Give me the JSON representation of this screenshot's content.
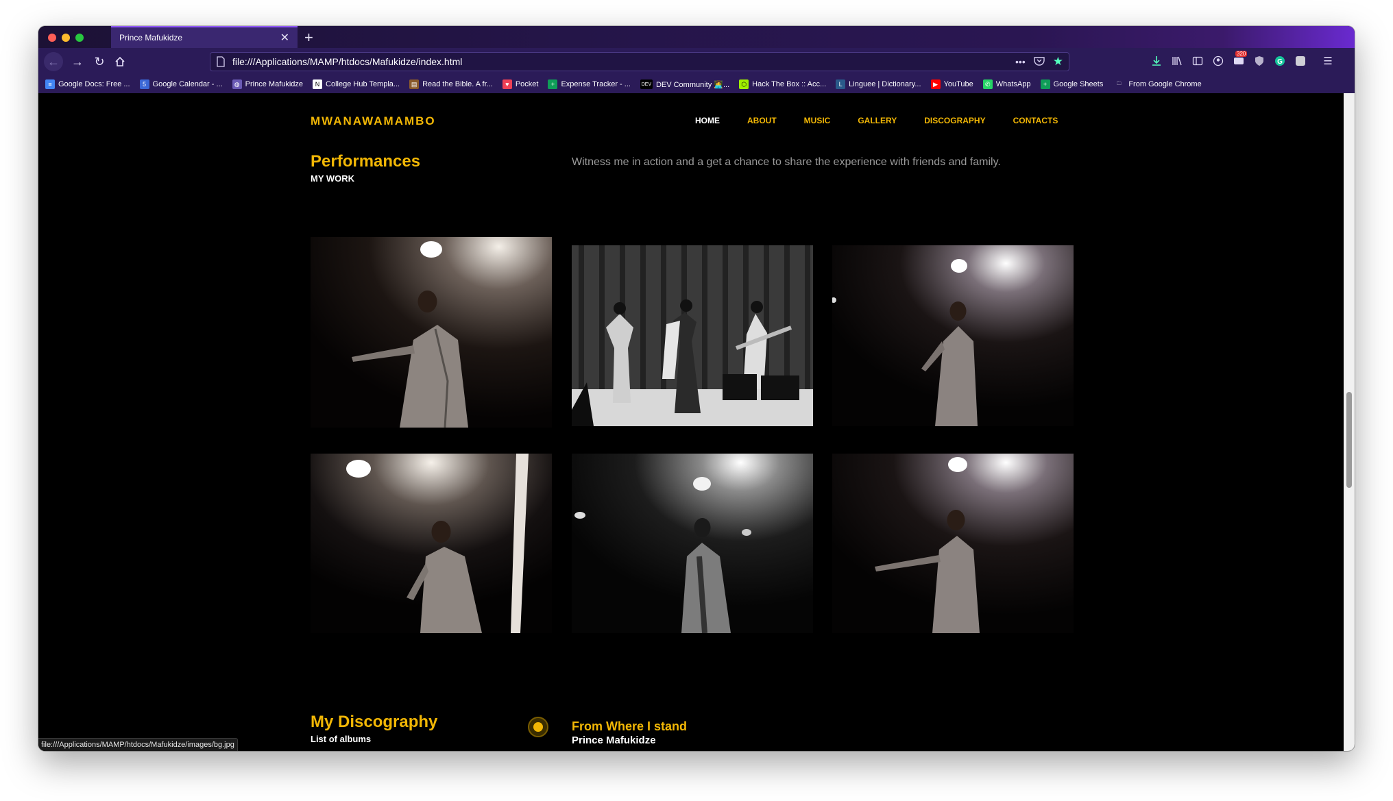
{
  "browser": {
    "tab_title": "Prince Mafukidze",
    "url": "file:///Applications/MAMP/htdocs/Mafukidze/index.html",
    "badge_count": "320",
    "bookmarks": [
      {
        "label": "Google Docs: Free ...",
        "color": "#4285f4",
        "glyph": "≡"
      },
      {
        "label": "Google Calendar - ...",
        "color": "#3b67d6",
        "glyph": "5"
      },
      {
        "label": "Prince Mafukidze",
        "color": "#6b5bb5",
        "glyph": "◍"
      },
      {
        "label": "College Hub Templa...",
        "color": "#ffffff",
        "glyph": "N"
      },
      {
        "label": "Read the Bible. A fr...",
        "color": "#8a5a2b",
        "glyph": "▤"
      },
      {
        "label": "Pocket",
        "color": "#ef4056",
        "glyph": "♥"
      },
      {
        "label": "Expense Tracker - ...",
        "color": "#0f9d58",
        "glyph": "+"
      },
      {
        "label": "DEV Community 👩‍💻...",
        "color": "#000000",
        "glyph": "DEV"
      },
      {
        "label": "Hack The Box :: Acc...",
        "color": "#9fef00",
        "glyph": "⬡"
      },
      {
        "label": "Linguee | Dictionary...",
        "color": "#2a5a8a",
        "glyph": "L"
      },
      {
        "label": "YouTube",
        "color": "#ff0000",
        "glyph": "▶"
      },
      {
        "label": "WhatsApp",
        "color": "#25d366",
        "glyph": "✆"
      },
      {
        "label": "Google Sheets",
        "color": "#0f9d58",
        "glyph": "+"
      },
      {
        "label": "From Google Chrome",
        "color": "transparent",
        "glyph": "🗀"
      }
    ],
    "status_url": "file:///Applications/MAMP/htdocs/Mafukidze/images/bg.jpg"
  },
  "site": {
    "brand": "MWANAWAMAMBO",
    "nav": [
      {
        "label": "HOME",
        "active": true
      },
      {
        "label": "ABOUT",
        "active": false
      },
      {
        "label": "MUSIC",
        "active": false
      },
      {
        "label": "GALLERY",
        "active": false
      },
      {
        "label": "DISCOGRAPHY",
        "active": false
      },
      {
        "label": "CONTACTS",
        "active": false
      }
    ],
    "performances": {
      "title": "Performances",
      "subtitle": "MY WORK",
      "description": "Witness me in action and a get a chance to share the experience with friends and family."
    },
    "discography": {
      "title": "My Discography",
      "subtitle": "List of albums",
      "album_title": "From Where I stand",
      "album_artist": "Prince Mafukidze"
    },
    "colors": {
      "accent": "#f2b705",
      "background": "#000000"
    }
  }
}
